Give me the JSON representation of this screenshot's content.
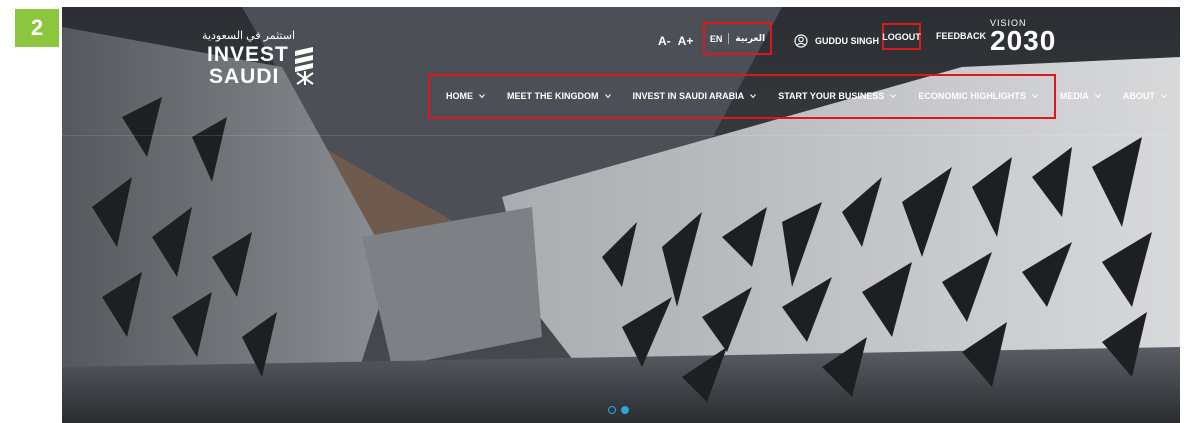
{
  "step": {
    "number": "2",
    "badge_color": "#8cc63f"
  },
  "logo": {
    "arabic": "استثمر في السعودية",
    "line1": "INVEST",
    "line2": "SAUDI"
  },
  "header": {
    "font_decrease": "A-",
    "font_increase": "A+",
    "lang_en": "EN",
    "lang_ar": "العربية",
    "user_name": "GUDDU SINGH",
    "logout": "LOGOUT",
    "feedback": "FEEDBACK",
    "vision_title": "VISION",
    "vision_year": "2030"
  },
  "nav": {
    "items": [
      {
        "label": "HOME"
      },
      {
        "label": "MEET THE KINGDOM"
      },
      {
        "label": "INVEST IN SAUDI ARABIA"
      },
      {
        "label": "START YOUR BUSINESS"
      },
      {
        "label": "ECONOMIC HIGHLIGHTS"
      },
      {
        "label": "MEDIA"
      },
      {
        "label": "ABOUT"
      }
    ]
  },
  "carousel": {
    "slides": 2,
    "active": 2
  },
  "colors": {
    "highlight": "#e0161e",
    "accent": "#2ea3d6"
  },
  "icons": [
    "user-icon",
    "chevron-down-icon",
    "invest-saudi-mark-icon"
  ]
}
